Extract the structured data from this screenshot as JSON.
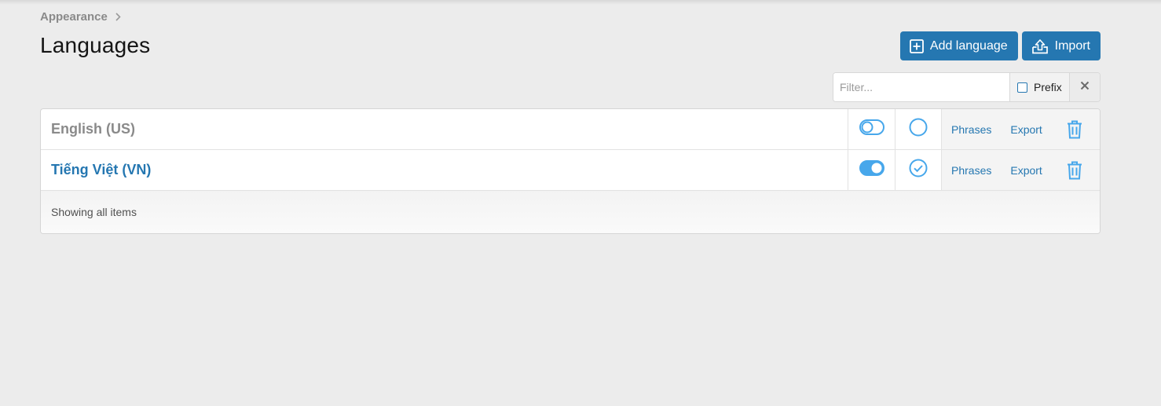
{
  "breadcrumb": {
    "parent": "Appearance"
  },
  "page": {
    "title": "Languages"
  },
  "actions": {
    "add_label": "Add language",
    "import_label": "Import"
  },
  "filter": {
    "placeholder": "Filter...",
    "value": "",
    "prefix_label": "Prefix",
    "prefix_checked": false
  },
  "languages": [
    {
      "name": "English (US)",
      "enabled": false,
      "default": false,
      "phrases_label": "Phrases",
      "export_label": "Export"
    },
    {
      "name": "Tiếng Việt (VN)",
      "enabled": true,
      "default": true,
      "phrases_label": "Phrases",
      "export_label": "Export"
    }
  ],
  "footer": {
    "status": "Showing all items"
  },
  "icons": {
    "add": "plus-square-icon",
    "import": "upload-tray-icon",
    "toggle": "toggle-switch-icon",
    "radio": "radio-circle-icon",
    "delete": "trash-icon",
    "clear": "close-icon",
    "breadcrumb_sep": "chevron-right-icon"
  },
  "colors": {
    "accent": "#2577b1",
    "toggle_blue": "#47a7eb",
    "muted": "#8a8a8a",
    "background": "#ececec"
  }
}
